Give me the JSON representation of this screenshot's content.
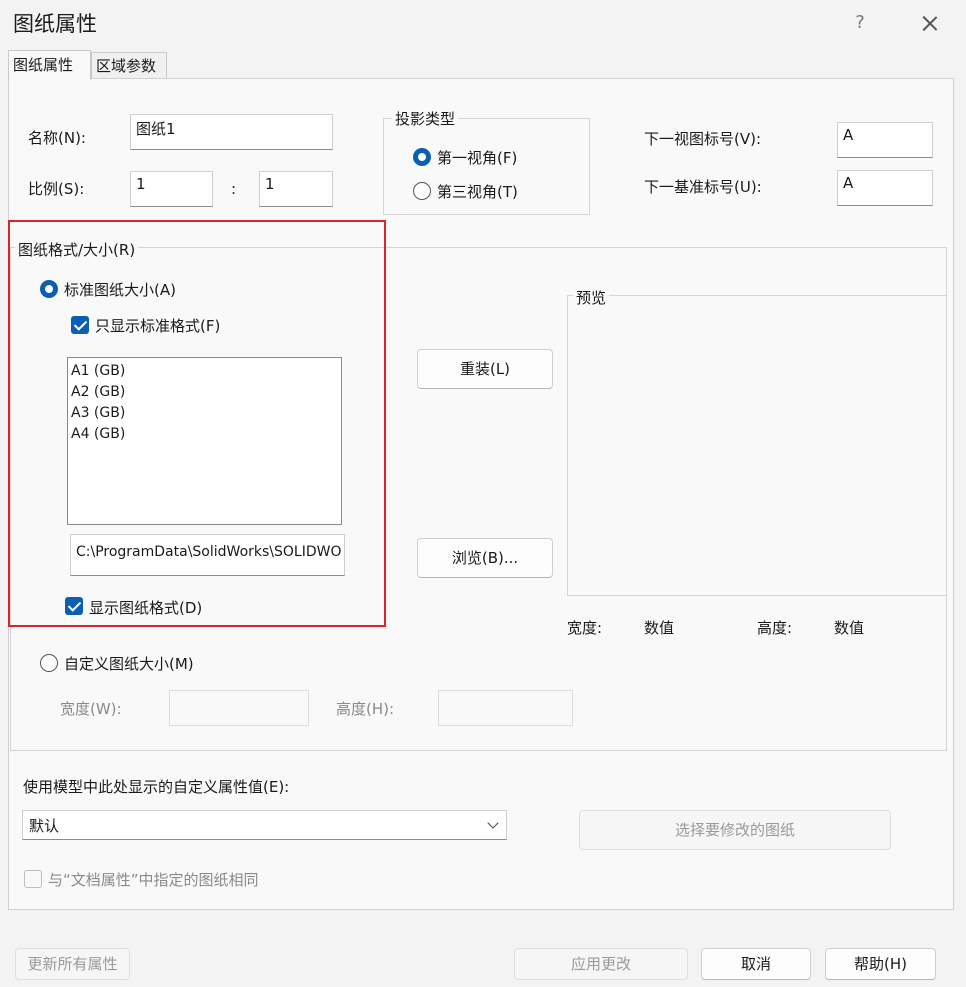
{
  "window": {
    "title": "图纸属性",
    "help": "?"
  },
  "tabs": [
    {
      "label": "图纸属性"
    },
    {
      "label": "区域参数"
    }
  ],
  "sheet": {
    "name_label": "名称(N):",
    "name_value": "图纸1",
    "scale_label": "比例(S):",
    "scale_num": "1",
    "scale_sep": ":",
    "scale_den": "1"
  },
  "projection": {
    "title": "投影类型",
    "first_angle": "第一视角(F)",
    "third_angle": "第三视角(T)"
  },
  "labels": {
    "next_view_label": "下一视图标号(V):",
    "next_view_value": "A",
    "next_datum_label": "下一基准标号(U):",
    "next_datum_value": "A"
  },
  "format": {
    "title": "图纸格式/大小(R)",
    "standard_label": "标准图纸大小(A)",
    "only_standard_label": "只显示标准格式(F)",
    "sizes": [
      "A1 (GB)",
      "A2 (GB)",
      "A3 (GB)",
      "A4 (GB)"
    ],
    "path": "C:\\ProgramData\\SolidWorks\\SOLIDWO",
    "show_format_label": "显示图纸格式(D)",
    "reload_button": "重装(L)",
    "browse_button": "浏览(B)...",
    "custom_label": "自定义图纸大小(M)",
    "width_label": "宽度(W):",
    "height_label": "高度(H):"
  },
  "preview": {
    "title": "预览",
    "width_label": "宽度:",
    "width_value": "数值",
    "height_label": "高度:",
    "height_value": "数值"
  },
  "custom_props": {
    "label": "使用模型中此处显示的自定义属性值(E):",
    "selected": "默认",
    "select_sheet_button": "选择要修改的图纸",
    "same_as_doc_label": "与“文档属性”中指定的图纸相同"
  },
  "footer": {
    "update_all": "更新所有属性",
    "apply": "应用更改",
    "cancel": "取消",
    "help": "帮助(H)"
  },
  "colors": {
    "accent": "#0a5fb5",
    "highlight_box": "#d7262e"
  }
}
